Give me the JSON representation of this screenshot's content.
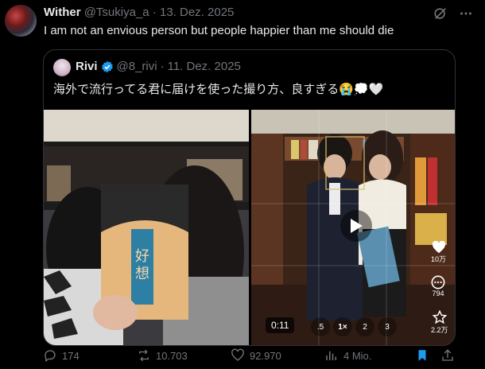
{
  "post": {
    "display_name": "Wither",
    "handle": "@Tsukiya_a",
    "separator": "·",
    "date": "13. Dez. 2025",
    "text": "I am not an envious person but people happier than me should die"
  },
  "quote": {
    "display_name": "Rivi",
    "handle": "@8_rivi",
    "separator": "·",
    "date": "11. Dez. 2025",
    "text": "海外で流行ってる君に届けを使った撮り方、良すぎる😭💭🤍",
    "video": {
      "time": "0:11",
      "speeds": [
        ".5",
        "1×",
        "2",
        "3"
      ],
      "likes": "10万",
      "comments": "794",
      "saves": "2.2万"
    }
  },
  "actions": {
    "replies": "174",
    "reposts": "10.703",
    "likes": "92.970",
    "views": "4 Mio."
  },
  "icons": {
    "grok": "grok-icon",
    "more": "more-icon",
    "verified": "verified-badge-icon",
    "reply": "reply-icon",
    "repost": "repost-icon",
    "like": "heart-icon",
    "views": "views-icon",
    "bookmark": "bookmark-icon",
    "share": "share-icon"
  },
  "colors": {
    "accent": "#1d9bf0",
    "muted": "#71767b",
    "text": "#e7e9ea",
    "border": "#2f3336"
  }
}
